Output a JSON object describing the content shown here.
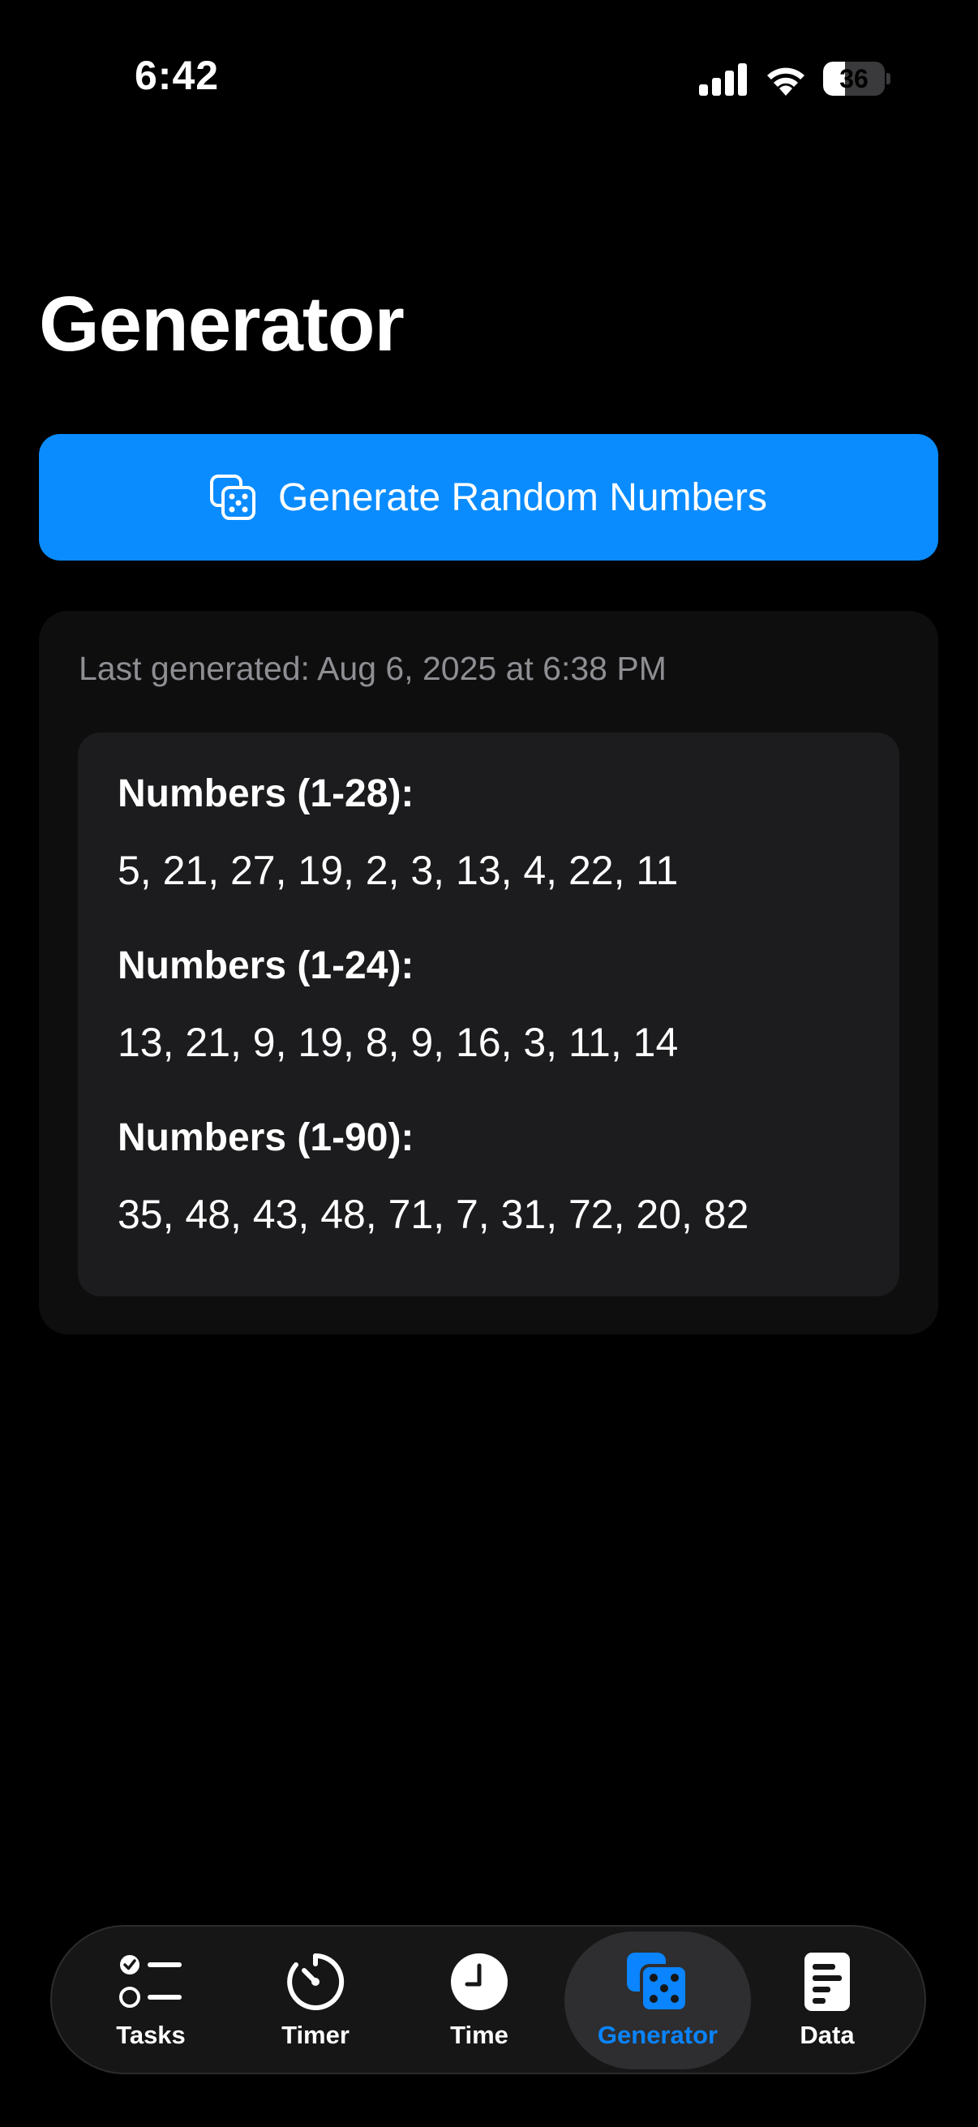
{
  "status_bar": {
    "time": "6:42",
    "battery": "36",
    "battery_level": 0.36,
    "icons": [
      "signal-icon",
      "wifi-icon",
      "battery-icon"
    ]
  },
  "title": "Generator",
  "generate_button": {
    "label": "Generate Random Numbers",
    "icon": "dice-icon"
  },
  "results": {
    "last_generated": "Last generated: Aug 6, 2025 at 6:38 PM",
    "sets": [
      {
        "title": "Numbers (1-28):",
        "values": "5, 21, 27, 19, 2, 3, 13, 4, 22, 11"
      },
      {
        "title": "Numbers (1-24):",
        "values": "13, 21, 9, 19, 8, 9, 16, 3, 11, 14"
      },
      {
        "title": "Numbers (1-90):",
        "values": "35, 48, 43, 48, 71, 7, 31, 72, 20, 82"
      }
    ]
  },
  "tab_bar": {
    "active": "Generator",
    "accent_color": "#0a84ff",
    "tabs": [
      {
        "label": "Tasks",
        "icon": "checklist-icon"
      },
      {
        "label": "Timer",
        "icon": "timer-icon"
      },
      {
        "label": "Time",
        "icon": "clock-icon"
      },
      {
        "label": "Generator",
        "icon": "dice-icon"
      },
      {
        "label": "Data",
        "icon": "document-icon"
      }
    ]
  },
  "colors": {
    "background": "#000000",
    "button": "#0a8cff",
    "card": "#0e0e0f",
    "inner_card": "#1c1c1e",
    "secondary_text": "#8e8e93"
  }
}
